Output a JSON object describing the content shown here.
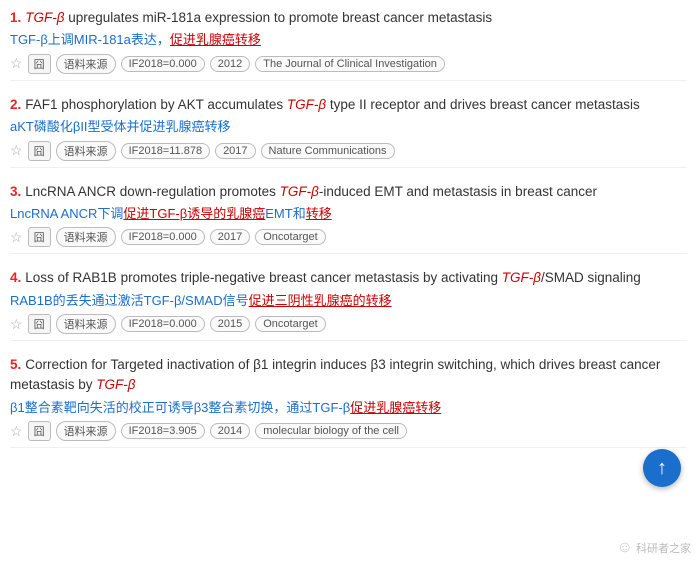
{
  "results": [
    {
      "number": "1.",
      "title_parts": [
        {
          "text": "TGF-β",
          "style": "italic-red"
        },
        {
          "text": " upregulates miR-181a expression to promote breast cancer metastasis",
          "style": "normal"
        }
      ],
      "subtitle_parts": [
        {
          "text": "TGF-β上调MIR-181a表达，",
          "style": "normal"
        },
        {
          "text": "促进乳腺癌转移",
          "style": "underline-red"
        }
      ],
      "meta": {
        "source_label": "语料来源",
        "if_label": "IF2018=0.000",
        "year": "2012",
        "journal": "The Journal of Clinical Investigation"
      }
    },
    {
      "number": "2.",
      "title_parts": [
        {
          "text": "FAF1 phosphorylation by AKT accumulates ",
          "style": "normal"
        },
        {
          "text": "TGF-β",
          "style": "italic-red"
        },
        {
          "text": " type II receptor and drives breast cancer metastasis",
          "style": "normal"
        }
      ],
      "subtitle_parts": [
        {
          "text": "aKT磷酸化βII型受体并促进乳腺癌转移",
          "style": "normal"
        }
      ],
      "meta": {
        "source_label": "语料来源",
        "if_label": "IF2018=11.878",
        "year": "2017",
        "journal": "Nature Communications"
      }
    },
    {
      "number": "3.",
      "title_parts": [
        {
          "text": "LncRNA ANCR down-regulation promotes ",
          "style": "normal"
        },
        {
          "text": "TGF-β",
          "style": "italic-red"
        },
        {
          "text": "-induced EMT and metastasis in breast cancer",
          "style": "normal"
        }
      ],
      "subtitle_parts": [
        {
          "text": "LncRNA ANCR下调",
          "style": "normal"
        },
        {
          "text": "促进TGF-β诱导的",
          "style": "underline-red"
        },
        {
          "text": "乳腺癌",
          "style": "underline-red"
        },
        {
          "text": "EMT和",
          "style": "normal"
        },
        {
          "text": "转移",
          "style": "underline-red"
        }
      ],
      "meta": {
        "source_label": "语料来源",
        "if_label": "IF2018=0.000",
        "year": "2017",
        "journal": "Oncotarget"
      }
    },
    {
      "number": "4.",
      "title_parts": [
        {
          "text": "Loss of RAB1B promotes triple-negative breast cancer metastasis by activating ",
          "style": "normal"
        },
        {
          "text": "TGF-β",
          "style": "italic-red"
        },
        {
          "text": "/SMAD signaling",
          "style": "normal"
        }
      ],
      "subtitle_parts": [
        {
          "text": "RAB1B的丢失通过激活TGF-β/SMAD信号",
          "style": "normal"
        },
        {
          "text": "促进三阴性乳腺癌的",
          "style": "underline-red"
        },
        {
          "text": "转移",
          "style": "underline-red"
        }
      ],
      "meta": {
        "source_label": "语料来源",
        "if_label": "IF2018=0.000",
        "year": "2015",
        "journal": "Oncotarget"
      }
    },
    {
      "number": "5.",
      "title_parts": [
        {
          "text": "Correction for Targeted inactivation of β1 integrin induces β3 integrin switching, which drives breast cancer metastasis by ",
          "style": "normal"
        },
        {
          "text": "TGF-β",
          "style": "italic-red"
        }
      ],
      "subtitle_parts": [
        {
          "text": "β1整合素靶向失活的校正可诱导β3整合素切换，通过TGF-β",
          "style": "normal"
        },
        {
          "text": "促进乳腺癌转移",
          "style": "underline-red"
        }
      ],
      "meta": {
        "source_label": "语料来源",
        "if_label": "IF2018=3.905",
        "year": "2014",
        "journal": "molecular biology of the cell"
      }
    }
  ],
  "up_arrow_label": "↑",
  "watermark_text": "科研者之家"
}
